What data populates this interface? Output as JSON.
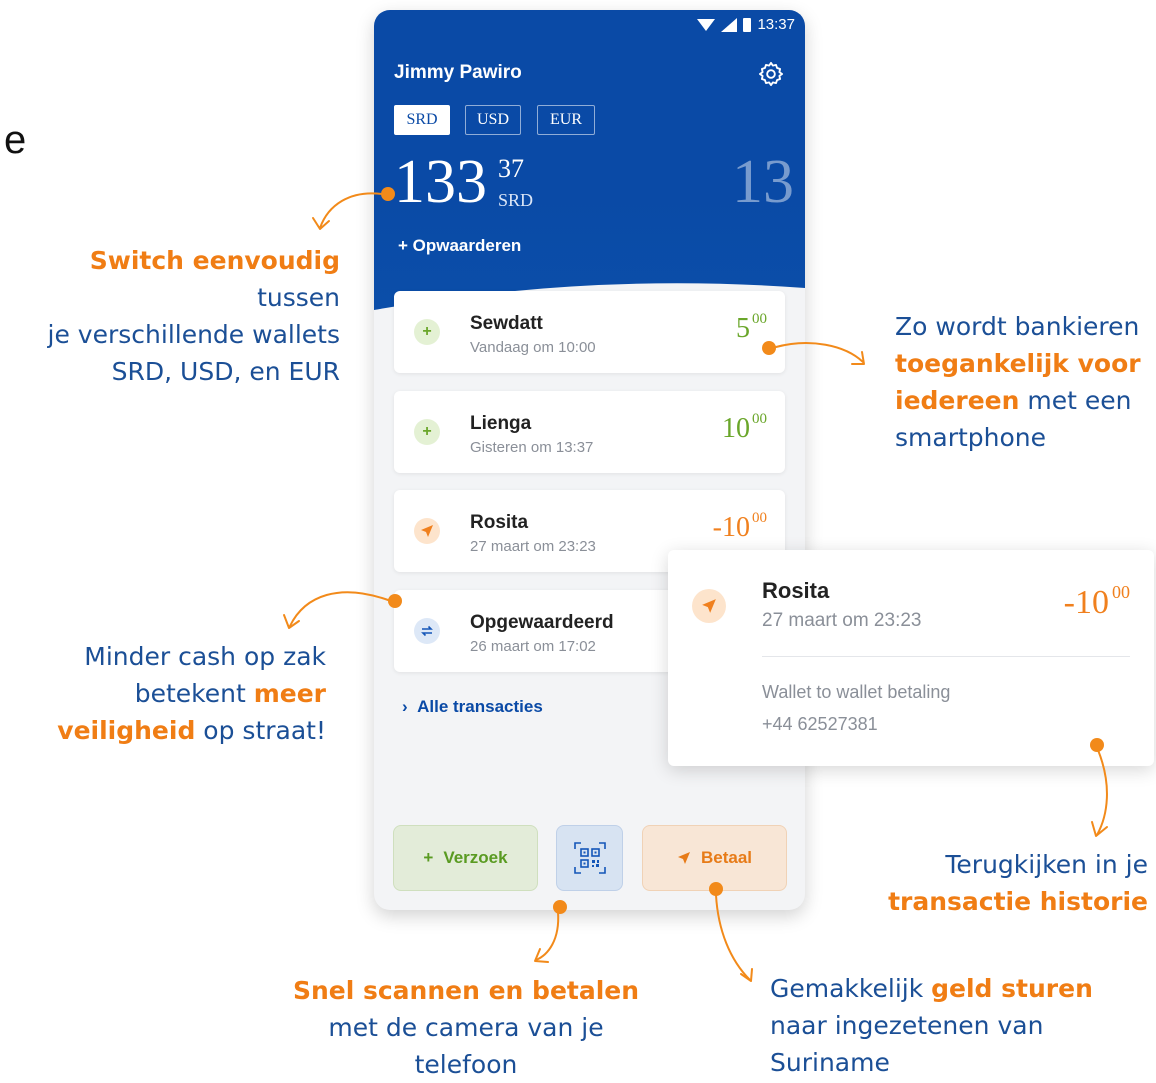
{
  "stray_text": "e",
  "status_bar": {
    "time": "13:37"
  },
  "user": {
    "name": "Jimmy Pawiro"
  },
  "currencies": [
    {
      "label": "SRD",
      "selected": true
    },
    {
      "label": "USD",
      "selected": false
    },
    {
      "label": "EUR",
      "selected": false
    }
  ],
  "balance": {
    "integer": "133",
    "decimals": "37",
    "currency": "SRD",
    "next_preview": "13"
  },
  "topup_label": "+ Opwaarderen",
  "transactions": [
    {
      "name": "Sewdatt",
      "date": "Vandaag om 10:00",
      "amount": "5",
      "cents": "00",
      "type": "in"
    },
    {
      "name": "Lienga",
      "date": "Gisteren om 13:37",
      "amount": "10",
      "cents": "00",
      "type": "in"
    },
    {
      "name": "Rosita",
      "date": "27 maart om 23:23",
      "amount": "-10",
      "cents": "00",
      "type": "out"
    },
    {
      "name": "Opgewaardeerd",
      "date": "26 maart om 17:02",
      "type": "topup"
    }
  ],
  "all_transactions_label": "Alle transacties",
  "buttons": {
    "request": "Verzoek",
    "pay": "Betaal"
  },
  "detail": {
    "name": "Rosita",
    "date": "27 maart om 23:23",
    "amount": "-10",
    "cents": "00",
    "description": "Wallet to wallet betaling",
    "phone": "+44 62527381"
  },
  "annotations": {
    "wallets": {
      "h1": "Switch eenvoudig",
      "t1": " tussen",
      "l2": "je verschillende wallets",
      "l3": "SRD, USD, en EUR"
    },
    "bank": {
      "l1": "Zo wordt bankieren",
      "h1": "toegankelijk voor",
      "h2": "iedereen",
      "t2": " met een",
      "l4": "smartphone"
    },
    "cash": {
      "l1": "Minder cash op zak",
      "t2": "betekent ",
      "h1": "meer",
      "h2": "veiligheid",
      "t3": " op straat!"
    },
    "history": {
      "l1": "Terugkijken in je",
      "h1": "transactie historie"
    },
    "scan": {
      "h1": "Snel scannen en betalen",
      "l2": "met de camera van je",
      "l3": "telefoon"
    },
    "send": {
      "t1": "Gemakkelijk ",
      "h1": "geld sturen",
      "l2": "naar ingezetenen van",
      "l3": "Suriname"
    }
  },
  "colors": {
    "brand_blue": "#0a4aa6",
    "accent_orange": "#f07d14",
    "positive_green": "#6aa62a"
  }
}
